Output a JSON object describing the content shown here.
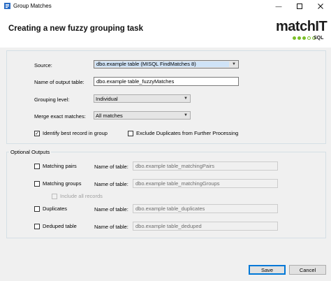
{
  "window": {
    "title": "Group Matches"
  },
  "header": {
    "heading": "Creating a new fuzzy grouping task",
    "logo_text": "matchIT",
    "logo_sub": "SQL"
  },
  "form": {
    "source_label": "Source:",
    "source_value": "dbo.example table  (MISQL FindMatches 8)",
    "output_table_label": "Name of output table:",
    "output_table_value": "dbo.example table_fuzzyMatches",
    "grouping_level_label": "Grouping level:",
    "grouping_level_value": "Individual",
    "merge_label": "Merge exact matches:",
    "merge_value": "All matches",
    "identify_best_label": "Identify best record in group",
    "identify_best_checked": true,
    "exclude_duplicates_label": "Exclude Duplicates from Further Processing",
    "exclude_duplicates_checked": false
  },
  "optional_outputs": {
    "legend": "Optional Outputs",
    "name_of_table_label": "Name of table:",
    "include_all_records_label": "Include all records",
    "rows": [
      {
        "label": "Matching pairs",
        "table": "dbo.example table_matchingPairs"
      },
      {
        "label": "Matching groups",
        "table": "dbo.example table_matchingGroups"
      },
      {
        "label": "Duplicates",
        "table": "dbo.example table_duplicates"
      },
      {
        "label": "Deduped table",
        "table": "dbo.example table_deduped"
      }
    ]
  },
  "footer": {
    "save_label": "Save",
    "cancel_label": "Cancel"
  },
  "icons": {
    "minimize": "minimize-icon",
    "maximize": "maximize-icon",
    "close": "close-icon",
    "dropdown": "chevron-down-icon",
    "check": "checkmark-icon"
  },
  "colors": {
    "accent": "#0078d7",
    "logo_green": "#7bbf28",
    "form_background": "#f0f0f0"
  }
}
